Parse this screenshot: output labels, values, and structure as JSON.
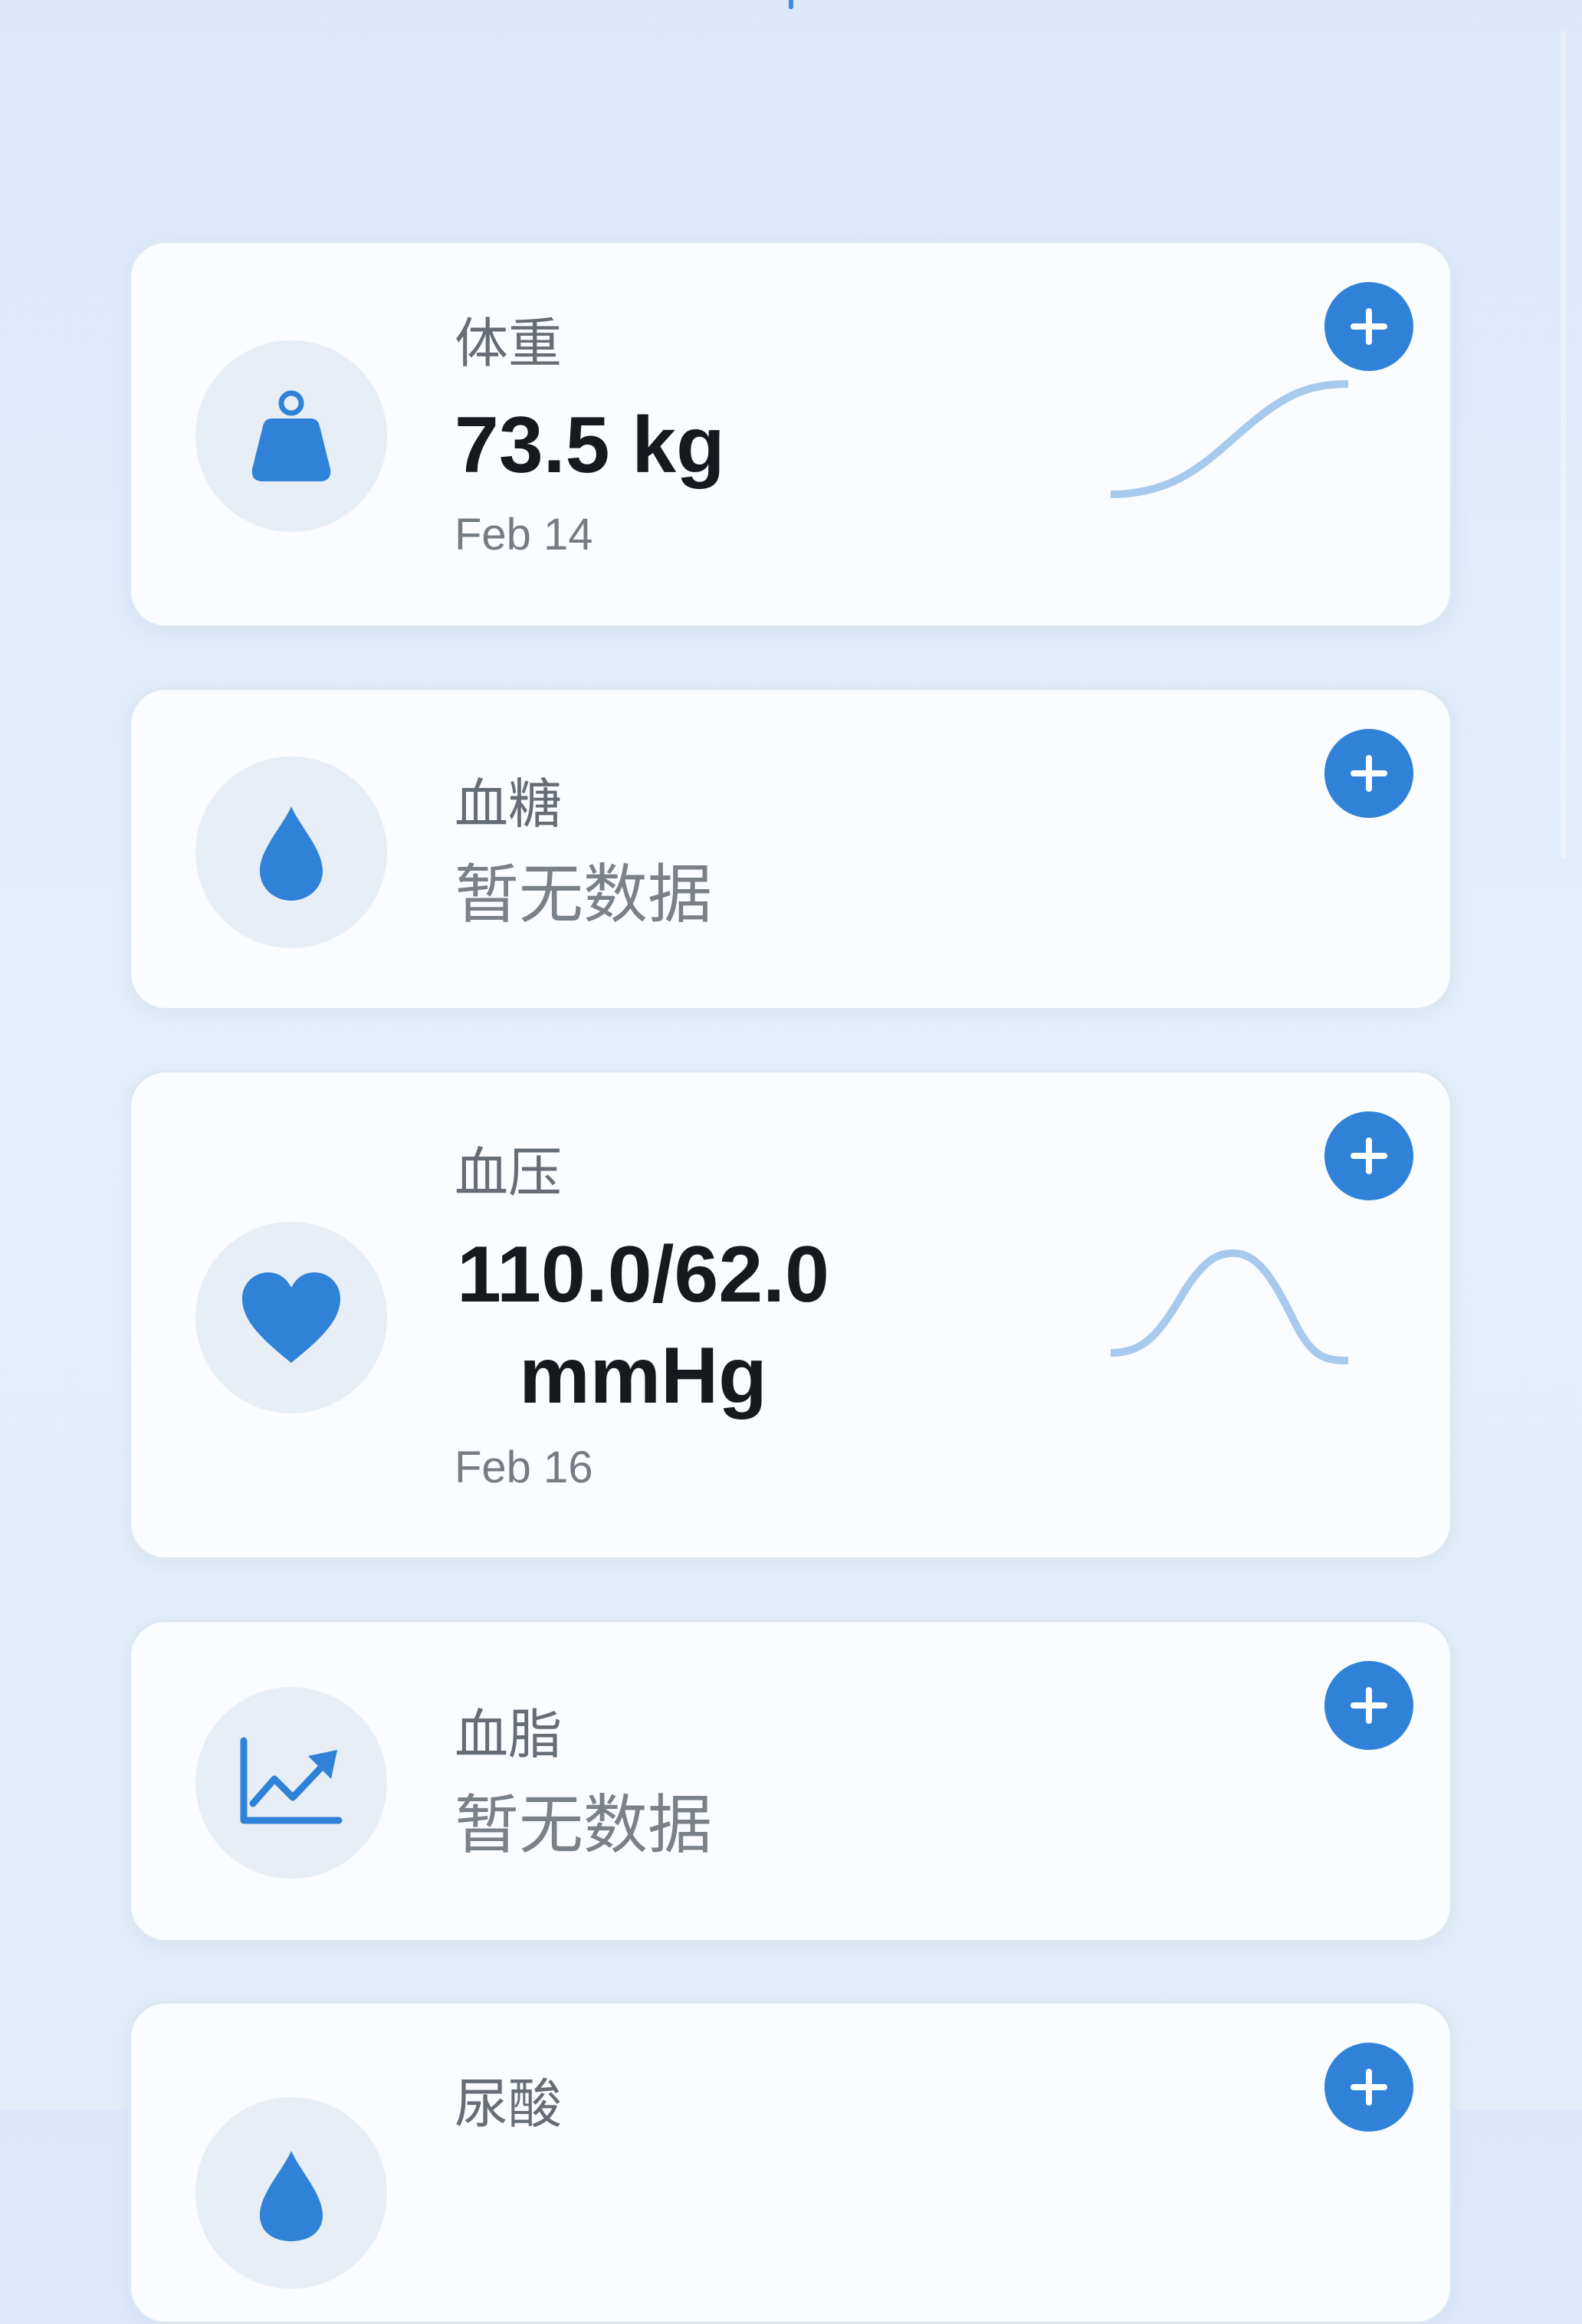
{
  "metrics": [
    {
      "label": "体重",
      "icon": "weight-icon",
      "value": "73.5 kg",
      "date": "Feb 14",
      "trend": [
        73.0,
        73.5
      ]
    },
    {
      "label": "血糖",
      "icon": "blood-drop-icon",
      "empty_text": "暂无数据"
    },
    {
      "label": "血压",
      "icon": "heart-icon",
      "value_line1": "110.0/62.0",
      "value_line2": "mmHg",
      "date": "Feb 16",
      "trend": [
        108.0,
        110.0,
        108.0
      ]
    },
    {
      "label": "血脂",
      "icon": "trend-chart-icon",
      "empty_text": "暂无数据"
    },
    {
      "label": "尿酸",
      "icon": "urine-icon"
    }
  ],
  "colors": {
    "accent": "#2f82d8",
    "icon_bg": "#e8eef5",
    "sparkline": "#a6c9ec"
  }
}
